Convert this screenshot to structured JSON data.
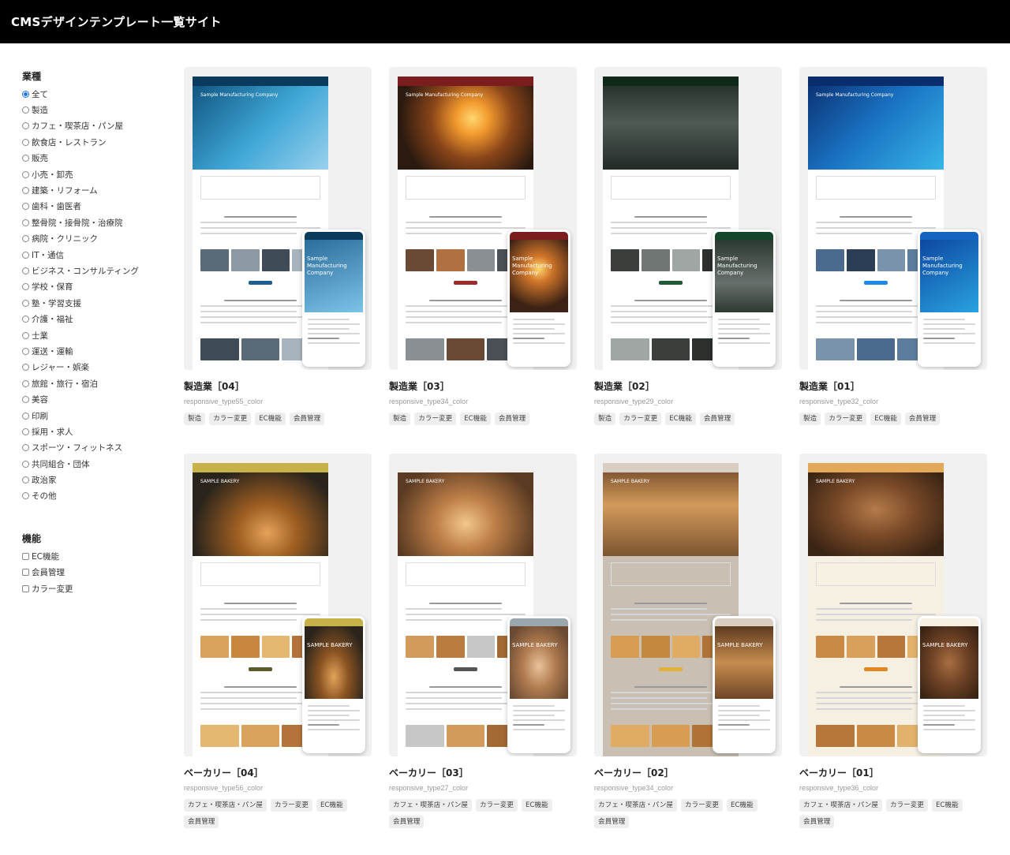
{
  "header": {
    "title": "CMSデザインテンプレート一覧サイト"
  },
  "filters": {
    "industry": {
      "heading": "業種",
      "options": [
        {
          "label": "全て",
          "checked": true
        },
        {
          "label": "製造",
          "checked": false
        },
        {
          "label": "カフェ・喫茶店・パン屋",
          "checked": false
        },
        {
          "label": "飲食店・レストラン",
          "checked": false
        },
        {
          "label": "販売",
          "checked": false
        },
        {
          "label": "小売・卸売",
          "checked": false
        },
        {
          "label": "建築・リフォーム",
          "checked": false
        },
        {
          "label": "歯科・歯医者",
          "checked": false
        },
        {
          "label": "整骨院・接骨院・治療院",
          "checked": false
        },
        {
          "label": "病院・クリニック",
          "checked": false
        },
        {
          "label": "IT・通信",
          "checked": false
        },
        {
          "label": "ビジネス・コンサルティング",
          "checked": false
        },
        {
          "label": "学校・保育",
          "checked": false
        },
        {
          "label": "塾・学習支援",
          "checked": false
        },
        {
          "label": "介護・福祉",
          "checked": false
        },
        {
          "label": "士業",
          "checked": false
        },
        {
          "label": "運送・運輸",
          "checked": false
        },
        {
          "label": "レジャー・娯楽",
          "checked": false
        },
        {
          "label": "旅館・旅行・宿泊",
          "checked": false
        },
        {
          "label": "美容",
          "checked": false
        },
        {
          "label": "印刷",
          "checked": false
        },
        {
          "label": "採用・求人",
          "checked": false
        },
        {
          "label": "スポーツ・フィットネス",
          "checked": false
        },
        {
          "label": "共同組合・団体",
          "checked": false
        },
        {
          "label": "政治家",
          "checked": false
        },
        {
          "label": "その他",
          "checked": false
        }
      ]
    },
    "features": {
      "heading": "機能",
      "options": [
        {
          "label": "EC機能",
          "checked": false
        },
        {
          "label": "会員管理",
          "checked": false
        },
        {
          "label": "カラー変更",
          "checked": false
        }
      ]
    }
  },
  "cards": [
    {
      "title": "製造業［04］",
      "code": "responsive_type55_color",
      "tags": [
        "製造",
        "カラー変更",
        "EC機能",
        "会員管理"
      ],
      "hero_text": "Sample Manufacturing Company",
      "phone_text": "Sample Manufacturing Company"
    },
    {
      "title": "製造業［03］",
      "code": "responsive_type34_color",
      "tags": [
        "製造",
        "カラー変更",
        "EC機能",
        "会員管理"
      ],
      "hero_text": "Sample Manufacturing Company",
      "phone_text": "Sample Manufacturing Company"
    },
    {
      "title": "製造業［02］",
      "code": "responsive_type29_color",
      "tags": [
        "製造",
        "カラー変更",
        "EC機能",
        "会員管理"
      ],
      "hero_text": "",
      "phone_text": "Sample Manufacturing Company"
    },
    {
      "title": "製造業［01］",
      "code": "responsive_type32_color",
      "tags": [
        "製造",
        "カラー変更",
        "EC機能",
        "会員管理"
      ],
      "hero_text": "Sample Manufacturing Company",
      "phone_text": "Sample Manufacturing Company"
    },
    {
      "title": "ベーカリー［04］",
      "code": "responsive_type56_color",
      "tags": [
        "カフェ・喫茶店・パン屋",
        "カラー変更",
        "EC機能",
        "会員管理"
      ],
      "hero_text": "SAMPLE BAKERY",
      "phone_text": "SAMPLE BAKERY"
    },
    {
      "title": "ベーカリー［03］",
      "code": "responsive_type27_color",
      "tags": [
        "カフェ・喫茶店・パン屋",
        "カラー変更",
        "EC機能",
        "会員管理"
      ],
      "hero_text": "SAMPLE BAKERY",
      "phone_text": "SAMPLE BAKERY"
    },
    {
      "title": "ベーカリー［02］",
      "code": "responsive_type34_color",
      "tags": [
        "カフェ・喫茶店・パン屋",
        "カラー変更",
        "EC機能",
        "会員管理"
      ],
      "hero_text": "SAMPLE BAKERY",
      "phone_text": "SAMPLE BAKERY"
    },
    {
      "title": "ベーカリー［01］",
      "code": "responsive_type36_color",
      "tags": [
        "カフェ・喫茶店・パン屋",
        "カラー変更",
        "EC機能",
        "会員管理"
      ],
      "hero_text": "SAMPLE BAKERY",
      "phone_text": "SAMPLE BAKERY"
    }
  ]
}
